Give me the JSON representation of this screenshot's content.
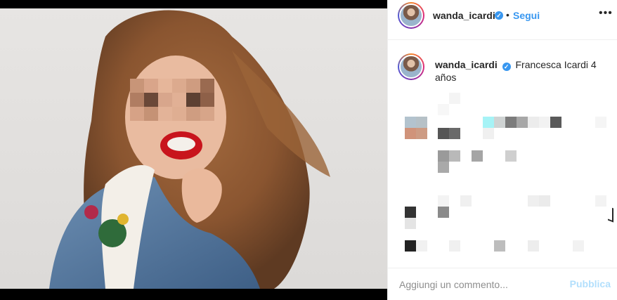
{
  "post": {
    "username": "wanda_icardi",
    "follow_label": "Segui",
    "separator": "•",
    "more_icon": "more-options-icon",
    "verified_icon": "verified-badge-icon"
  },
  "caption": {
    "username": "wanda_icardi",
    "text": "Francesca Icardi 4 años"
  },
  "comment_bar": {
    "placeholder": "Aggiungi un commento...",
    "post_label": "Pubblica"
  },
  "colors": {
    "accent": "#3897f0",
    "text": "#262626",
    "muted": "#8e8e8e",
    "post_disabled": "#b2dffc"
  }
}
